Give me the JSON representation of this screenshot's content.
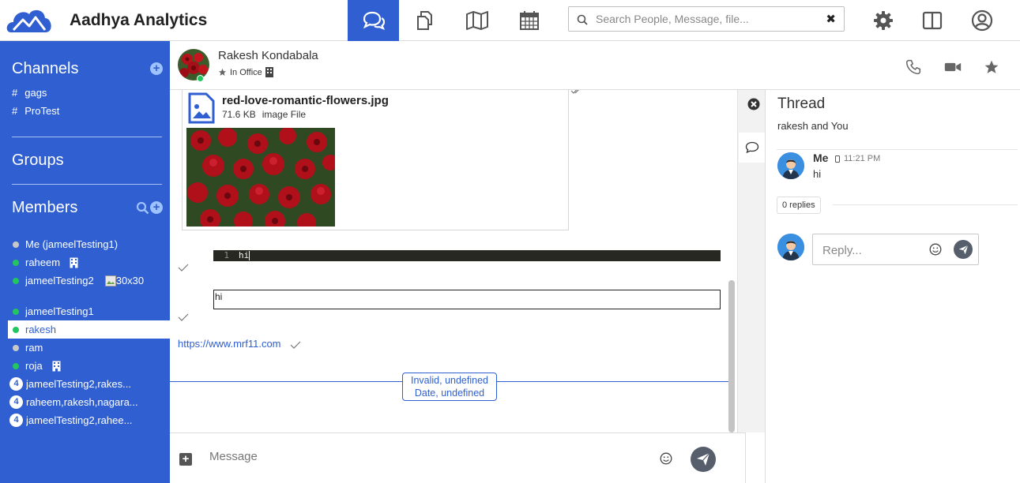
{
  "app": {
    "title": "Aadhya Analytics"
  },
  "header": {
    "search_placeholder": "Search People, Message, file...",
    "clear_glyph": "✖"
  },
  "sidebar": {
    "channels_title": "Channels",
    "channels": [
      {
        "hash": "#",
        "label": "gags"
      },
      {
        "hash": "#",
        "label": "ProTest"
      }
    ],
    "groups_title": "Groups",
    "members_title": "Members",
    "members": [
      {
        "label": "Me (jameelTesting1)",
        "status": "offline"
      },
      {
        "label": "raheem",
        "status": "online"
      },
      {
        "label": "jameelTesting2",
        "status": "online",
        "broken_image_alt": "30x30"
      },
      {
        "label": "jameelTesting1",
        "status": "online"
      },
      {
        "label": "rakesh",
        "status": "online",
        "active": true
      },
      {
        "label": "ram",
        "status": "offline"
      },
      {
        "label": "roja",
        "status": "online"
      },
      {
        "label": "jameelTesting2,rakes...",
        "badge": "4"
      },
      {
        "label": "raheem,rakesh,nagara...",
        "badge": "4"
      },
      {
        "label": "jameelTesting2,rahee...",
        "badge": "4"
      }
    ]
  },
  "chat": {
    "contact_name": "Rakesh Kondabala",
    "status_text": "In Office",
    "file": {
      "name": "red-love-romantic-flowers.jpg",
      "size": "71.6 KB",
      "type": "image File"
    },
    "code_line_number": "1",
    "code_text": "hi",
    "plain_text": "hi",
    "link_text": "https://www.mrf11.com",
    "date_line1": "Invalid, undefined",
    "date_line2": "Date, undefined",
    "composer_placeholder": "Message"
  },
  "thread": {
    "title": "Thread",
    "participants": "rakesh and You",
    "sender": "Me",
    "time": "11:21 PM",
    "message": "hi",
    "replies": "0 replies",
    "reply_placeholder": "Reply..."
  },
  "colors": {
    "brand": "#2f5fd0",
    "online": "#22c55e",
    "offline": "#c8c8c8",
    "code_bg": "#272822"
  }
}
